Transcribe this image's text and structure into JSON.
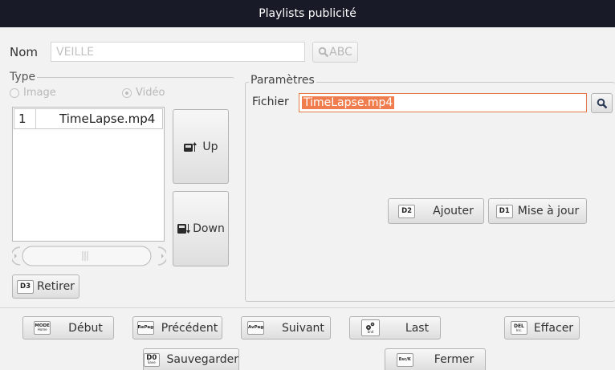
{
  "window": {
    "title": "Playlists publicité"
  },
  "name_field": {
    "label": "Nom",
    "value": "VEILLE",
    "keyboard_button": "ABC"
  },
  "type_group": {
    "label": "Type",
    "options": [
      {
        "label": "Image",
        "selected": false
      },
      {
        "label": "Vidéo",
        "selected": true
      }
    ]
  },
  "playlist": {
    "rows": [
      {
        "index": "1",
        "file": "TimeLapse.mp4"
      }
    ],
    "up_button": "Up",
    "down_button": "Down",
    "remove_button": {
      "key": "D3",
      "label": "Retirer"
    }
  },
  "params": {
    "label": "Paramètres",
    "file_label": "Fichier",
    "file_value": "TimeLapse.mp4",
    "add_button": {
      "key": "D2",
      "label": "Ajouter"
    },
    "update_button": {
      "key": "D1",
      "label": "Mise à jour"
    }
  },
  "footer": {
    "debut": {
      "key": "MODE",
      "key_sub": "Home",
      "label": "Début"
    },
    "precedent": {
      "key": "RePag",
      "label": "Précédent"
    },
    "suivant": {
      "key": "AvPag",
      "label": "Suivant"
    },
    "last": {
      "key_sub": "End",
      "label": "Last"
    },
    "effacer": {
      "key": "DEL",
      "key_sub": "Ins.",
      "label": "Effacer"
    },
    "sauvegarder": {
      "key": "D0",
      "key_sub": "Save",
      "label": "Sauvegarder"
    },
    "fermer": {
      "key": "Esc/K",
      "label": "Fermer"
    }
  },
  "colors": {
    "titlebar": "#181b27",
    "highlight": "#f07d4d",
    "focus_border": "#e07a4e"
  }
}
